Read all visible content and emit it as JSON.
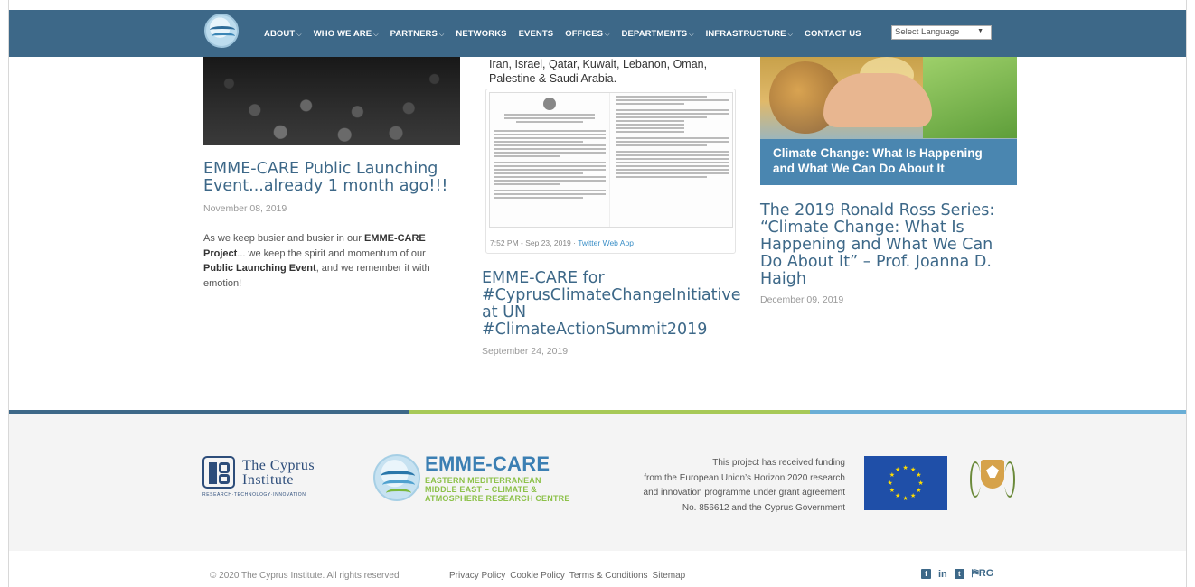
{
  "nav": {
    "items": [
      {
        "label": "ABOUT",
        "dropdown": true
      },
      {
        "label": "WHO WE ARE",
        "dropdown": true
      },
      {
        "label": "PARTNERS",
        "dropdown": true
      },
      {
        "label": "NETWORKS",
        "dropdown": false
      },
      {
        "label": "EVENTS",
        "dropdown": false
      },
      {
        "label": "OFFICES",
        "dropdown": true
      },
      {
        "label": "DEPARTMENTS",
        "dropdown": true
      },
      {
        "label": "INFRASTRUCTURE",
        "dropdown": true
      },
      {
        "label": "CONTACT US",
        "dropdown": false
      }
    ],
    "language_select": "Select Language",
    "bar_color": "#3d6888"
  },
  "posts": [
    {
      "title": "EMME-CARE Public Launching Event...already 1 month ago!!!",
      "date": "November 08, 2019",
      "excerpt_parts": [
        "As we keep busier and busier in our ",
        "EMME-CARE Project",
        "... we keep the spirit and momentum of our ",
        "Public Launching Event",
        ", and we remember it with emotion!"
      ]
    },
    {
      "top_text": "Iran, Israel, Qatar, Kuwait, Lebanon, Oman, Palestine & Saudi Arabia.",
      "tweet_time": "7:52 PM - Sep 23, 2019",
      "tweet_sep": " · ",
      "tweet_link": "Twitter Web App",
      "title": "EMME-CARE for #CyprusClimateChangeInitiative at UN #ClimateActionSummit2019",
      "date": "September 24, 2019"
    },
    {
      "image_caption": "Climate Change: What Is Happening and What We Can Do About It",
      "title": "The 2019 Ronald Ross Series: “Climate Change: What Is Happening and What We Can Do About It” – Prof. Joanna D. Haigh",
      "date": "December 09, 2019"
    }
  ],
  "footer": {
    "cyi": {
      "name_line1": "The Cyprus",
      "name_line2": "Institute",
      "tagline": "RESEARCH·TECHNOLOGY·INNOVATION"
    },
    "emme": {
      "title": "EMME-CARE",
      "sub1": "EASTERN MEDITERRANEAN",
      "sub2": "MIDDLE EAST – CLIMATE &",
      "sub3": "ATMOSPHERE RESEARCH CENTRE"
    },
    "funding_lines": [
      "This project has received funding",
      "from the European Union’s Horizon 2020 research",
      "and innovation programme under grant agreement",
      "No. 856612 and the Cyprus Government"
    ],
    "copyright": "© 2020 The Cyprus Institute. All rights reserved",
    "links": [
      "Privacy Policy",
      "Cookie Policy",
      "Terms & Conditions",
      "Sitemap"
    ],
    "social": [
      "facebook-icon",
      "linkedin-icon",
      "twitter-icon",
      "researchgate-icon"
    ],
    "social_rg_label": "RG",
    "rule_colors": [
      "#3d6888",
      "#a7c957",
      "#6aaed6"
    ]
  }
}
